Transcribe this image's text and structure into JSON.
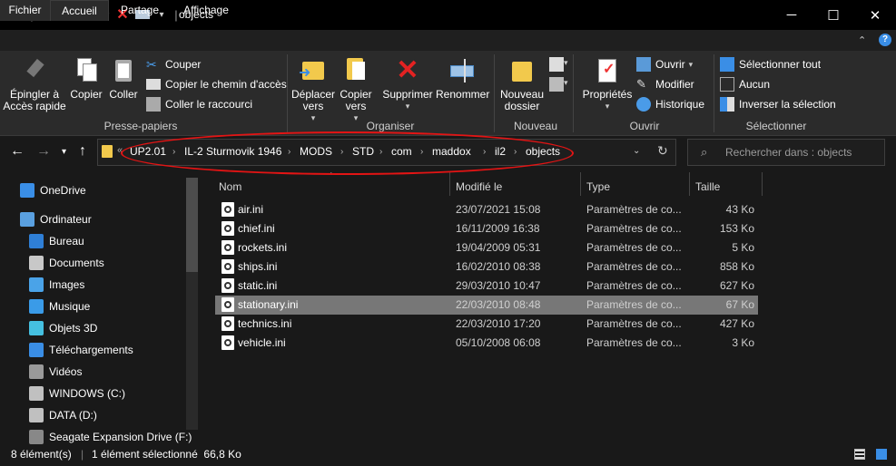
{
  "window": {
    "title": "objects"
  },
  "ribbon_tabs": [
    "Fichier",
    "Accueil",
    "Partage",
    "Affichage"
  ],
  "ribbon": {
    "pin": "Épingler à Accès rapide",
    "copy": "Copier",
    "paste": "Coller",
    "cut": "Couper",
    "copy_path": "Copier le chemin d'accès",
    "paste_shortcut": "Coller le raccourci",
    "move_to": "Déplacer vers",
    "copy_to": "Copier vers",
    "delete": "Supprimer",
    "rename": "Renommer",
    "new_folder": "Nouveau dossier",
    "properties": "Propriétés",
    "open": "Ouvrir",
    "modify": "Modifier",
    "history": "Historique",
    "select_all": "Sélectionner tout",
    "select_none": "Aucun",
    "invert_selection": "Inverser la sélection",
    "group_clipboard": "Presse-papiers",
    "group_organize": "Organiser",
    "group_new": "Nouveau",
    "group_open": "Ouvrir",
    "group_select": "Sélectionner"
  },
  "breadcrumb": [
    "UP2.01",
    "IL-2 Sturmovik 1946",
    "MODS",
    "STD",
    "com",
    "maddox",
    "il2",
    "objects"
  ],
  "search": {
    "placeholder": "Rechercher dans : objects"
  },
  "nav": [
    {
      "label": "OneDrive",
      "icon": "cloud-icon",
      "color": "#3a8ee6"
    },
    {
      "label": "Ordinateur",
      "icon": "computer-icon",
      "color": "#5aa0e0"
    },
    {
      "label": "Bureau",
      "icon": "desktop-icon",
      "color": "#2f7fd6"
    },
    {
      "label": "Documents",
      "icon": "document-icon",
      "color": "#c8c8c8"
    },
    {
      "label": "Images",
      "icon": "image-icon",
      "color": "#4aa3e8"
    },
    {
      "label": "Musique",
      "icon": "music-icon",
      "color": "#3a9be8"
    },
    {
      "label": "Objets 3D",
      "icon": "cube-icon",
      "color": "#45c0e0"
    },
    {
      "label": "Téléchargements",
      "icon": "download-icon",
      "color": "#3a8ee6"
    },
    {
      "label": "Vidéos",
      "icon": "video-icon",
      "color": "#9a9a9a"
    },
    {
      "label": "WINDOWS (C:)",
      "icon": "drive-icon",
      "color": "#c0c0c0"
    },
    {
      "label": "DATA (D:)",
      "icon": "drive-icon",
      "color": "#c0c0c0"
    },
    {
      "label": "Seagate Expansion Drive (F:)",
      "icon": "drive-icon",
      "color": "#888888"
    }
  ],
  "columns": {
    "name": "Nom",
    "modified": "Modifié le",
    "type": "Type",
    "size": "Taille"
  },
  "files": [
    {
      "name": "air.ini",
      "modified": "23/07/2021 15:08",
      "type": "Paramètres de co...",
      "size": "43 Ko"
    },
    {
      "name": "chief.ini",
      "modified": "16/11/2009 16:38",
      "type": "Paramètres de co...",
      "size": "153 Ko"
    },
    {
      "name": "rockets.ini",
      "modified": "19/04/2009 05:31",
      "type": "Paramètres de co...",
      "size": "5 Ko"
    },
    {
      "name": "ships.ini",
      "modified": "16/02/2010 08:38",
      "type": "Paramètres de co...",
      "size": "858 Ko"
    },
    {
      "name": "static.ini",
      "modified": "29/03/2010 10:47",
      "type": "Paramètres de co...",
      "size": "627 Ko"
    },
    {
      "name": "stationary.ini",
      "modified": "22/03/2010 08:48",
      "type": "Paramètres de co...",
      "size": "67 Ko"
    },
    {
      "name": "technics.ini",
      "modified": "22/03/2010 17:20",
      "type": "Paramètres de co...",
      "size": "427 Ko"
    },
    {
      "name": "vehicle.ini",
      "modified": "05/10/2008 06:08",
      "type": "Paramètres de co...",
      "size": "3 Ko"
    }
  ],
  "status": {
    "count": "8 élément(s)",
    "selected": "1 élément sélectionné  66,8 Ko"
  }
}
